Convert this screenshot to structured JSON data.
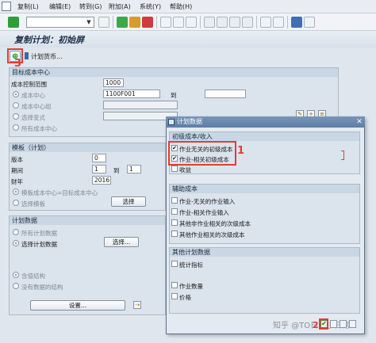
{
  "menubar": {
    "items": [
      "复制(L)",
      "编辑(E)",
      "转到(G)",
      "附加(A)",
      "系统(Y)",
      "帮助(H)"
    ]
  },
  "page": {
    "title": "复制计划：初始屏"
  },
  "app_toolbar": {
    "plan_currency_label": "计划货币...",
    "annotation_3": "3"
  },
  "group_target": {
    "title": "目标成本中心",
    "controlling_area_label": "成本控制范围",
    "controlling_area_value": "1000",
    "cost_center_label": "成本中心",
    "cost_center_value": "1100F001",
    "to_label": "到",
    "cost_center_group_label": "成本中心组",
    "select_variant_label": "选择变式",
    "all_cost_centers_label": "所有成本中心"
  },
  "group_template": {
    "title": "模板（计划）",
    "version_label": "版本",
    "version_value": "0",
    "period_label": "期间",
    "period_from": "1",
    "to_label": "到",
    "period_to": "1",
    "fiscal_year_label": "财年",
    "fiscal_year_value": "2016",
    "template_cc_label": "模板成本中心=目标成本中心",
    "template_select_label": "选择模板",
    "select_button": "选择"
  },
  "group_plan_data": {
    "title": "计划数据",
    "all_plan_data_label": "所有计划数据",
    "select_plan_data_label": "选择计划数据",
    "select_button": "选择...",
    "with_structure_label": "含值结构",
    "no_value_structure_label": "没有数据的结构",
    "settings_button": "设置..."
  },
  "dialog": {
    "title": "计划数据",
    "section_primary_title": "初级成本/收入",
    "primary_items": [
      "作业无关的初级成本",
      "作业-相关初级成本",
      "收益"
    ],
    "primary_checked": [
      true,
      true,
      false
    ],
    "annotation_1": "1",
    "section_secondary_title": "辅助成本",
    "secondary_items": [
      "作业-无关的作业输入",
      "作业-相关作业输入",
      "其他非作业相关的次级成本",
      "其他作业相关的次级成本"
    ],
    "section_other_title": "其他计划数据",
    "other_items": [
      "统计指标",
      "作业数量",
      "价格"
    ],
    "annotation_2": "2"
  },
  "watermark": "知乎 @TO日的小日常",
  "colors": {
    "annotation_red": "#e43b3b",
    "dialog_header": "#5d7ea7",
    "execute_green": "#0a8f2c"
  }
}
